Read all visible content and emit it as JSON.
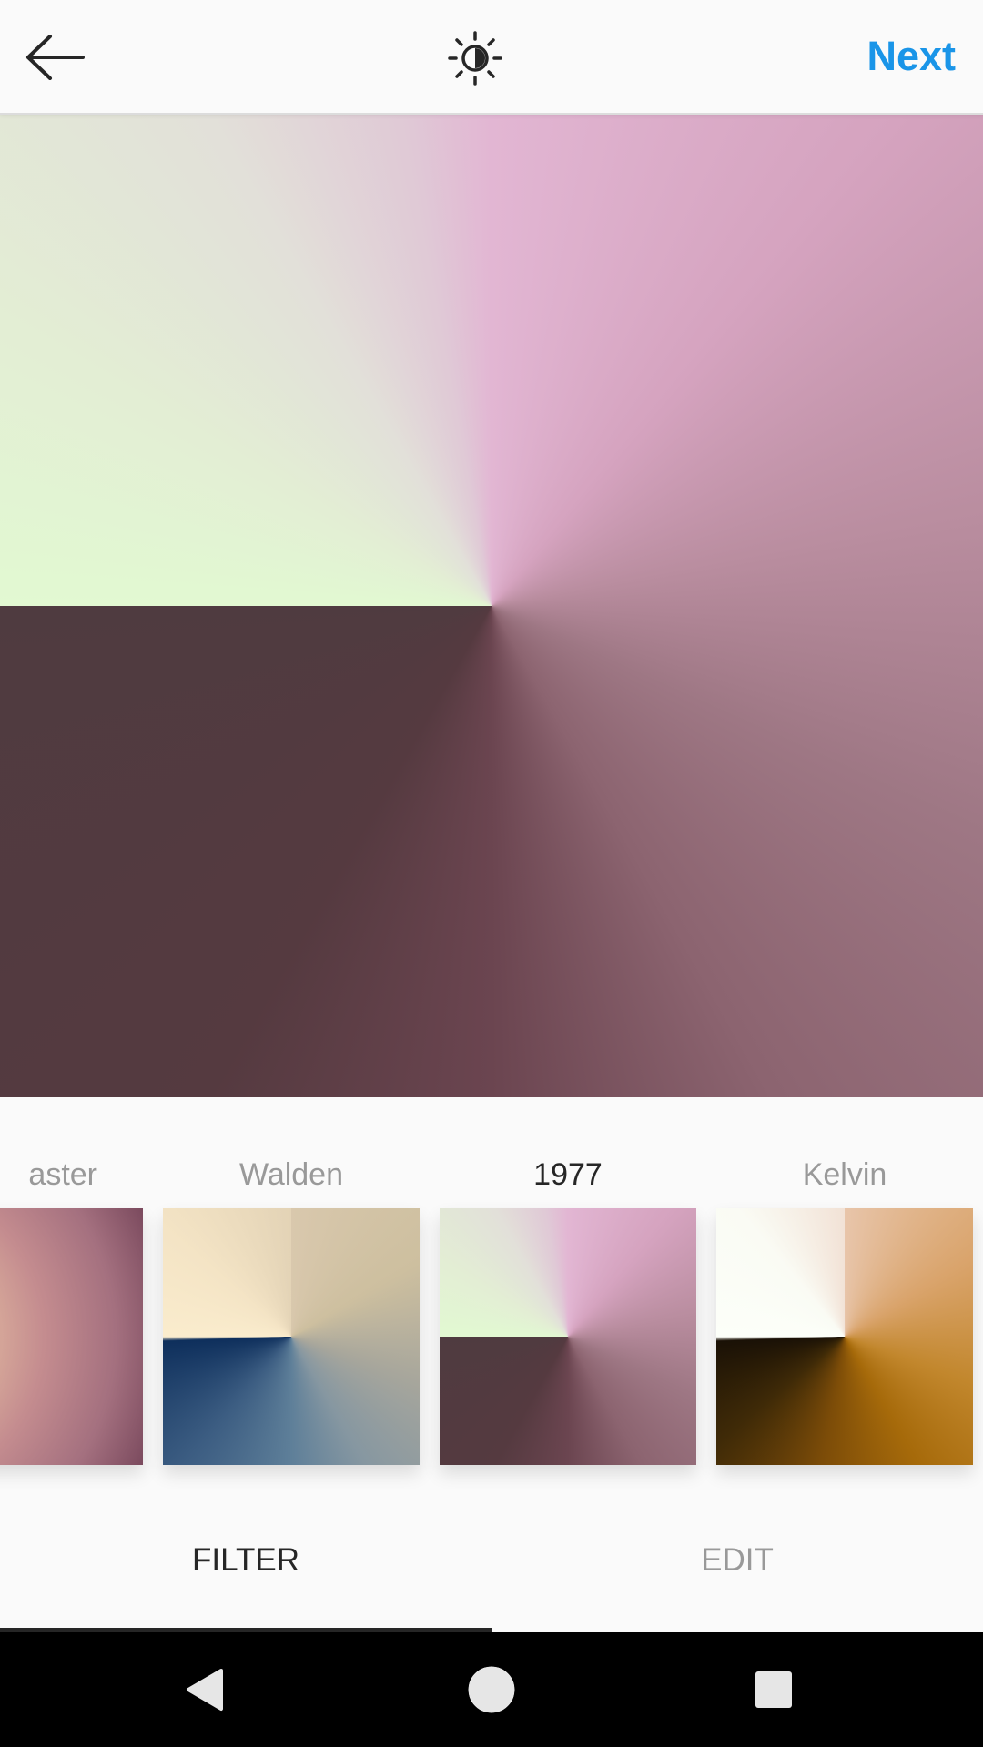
{
  "topbar": {
    "back_icon": "arrow-left-icon",
    "lux_icon": "brightness-sun-icon",
    "next_label": "Next",
    "accent_color": "#1a95e8"
  },
  "filters": [
    {
      "name": "aster",
      "selected": false
    },
    {
      "name": "Walden",
      "selected": false
    },
    {
      "name": "1977",
      "selected": true
    },
    {
      "name": "Kelvin",
      "selected": false
    }
  ],
  "tabs": {
    "filter_label": "FILTER",
    "edit_label": "EDIT",
    "active": "FILTER"
  },
  "navbar": {
    "back_icon": "nav-back-triangle-icon",
    "home_icon": "nav-home-circle-icon",
    "recents_icon": "nav-recents-square-icon"
  }
}
